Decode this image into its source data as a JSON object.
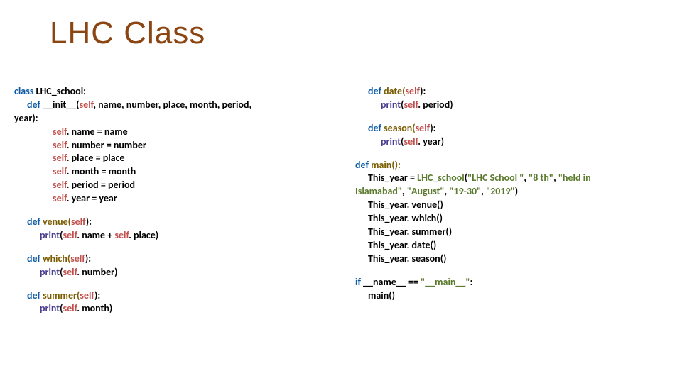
{
  "title": "LHC Class",
  "left": {
    "l1a": "class ",
    "l1b": "LHC_school:",
    "l2a": "def ",
    "l2b": "__init__(",
    "l2c": "self",
    "l2d": ", name, number, place, month, period,",
    "l3": "year):",
    "l4a": "self",
    "l4b": ". name = name",
    "l5a": "self",
    "l5b": ". number = number",
    "l6a": "self",
    "l6b": ". place = place",
    "l7a": "self",
    "l7b": ". month = month",
    "l8a": "self",
    "l8b": ". period = period",
    "l9a": "self",
    "l9b": ". year = year",
    "l10a": "def ",
    "l10b": "venue(",
    "l10c": "self",
    "l10d": "):",
    "l11a": "print",
    "l11b": "(",
    "l11c": "self",
    "l11d": ". name + ",
    "l11e": "self",
    "l11f": ". place)",
    "l12a": "def ",
    "l12b": "which(",
    "l12c": "self",
    "l12d": "):",
    "l13a": "print",
    "l13b": "(",
    "l13c": "self",
    "l13d": ". number)",
    "l14a": "def ",
    "l14b": "summer(",
    "l14c": "self",
    "l14d": "):",
    "l15a": "print",
    "l15b": "(",
    "l15c": "self",
    "l15d": ". month)"
  },
  "right": {
    "r1a": "def ",
    "r1b": "date(",
    "r1c": "self",
    "r1d": "):",
    "r2a": "print",
    "r2b": "(",
    "r2c": "self",
    "r2d": ". period)",
    "r3a": "def ",
    "r3b": "season(",
    "r3c": "self",
    "r3d": "):",
    "r4a": "print",
    "r4b": "(",
    "r4c": "self",
    "r4d": ". year)",
    "r5a": "def ",
    "r5b": "main():",
    "r6a": "This_year = ",
    "r6b": "LHC_school",
    "r6c": "(",
    "r6d": "\"LHC School \"",
    "r6e": ", ",
    "r6f": "\"8 th\"",
    "r6g": ",  ",
    "r6h": "\"held in",
    "r7a": "Islamabad\"",
    "r7b": ", ",
    "r7c": "\"August\"",
    "r7d": ", ",
    "r7e": "\"19-30\"",
    "r7f": ", ",
    "r7g": "\"2019\"",
    "r7h": ")",
    "r8": "This_year. venue()",
    "r9": "This_year. which()",
    "r10": "This_year. summer()",
    "r11": "This_year. date()",
    "r12": "This_year. season()",
    "r13a": "if ",
    "r13b": "__name__ == ",
    "r13c": "\"__main__\"",
    "r13d": ":",
    "r14": "main()"
  }
}
